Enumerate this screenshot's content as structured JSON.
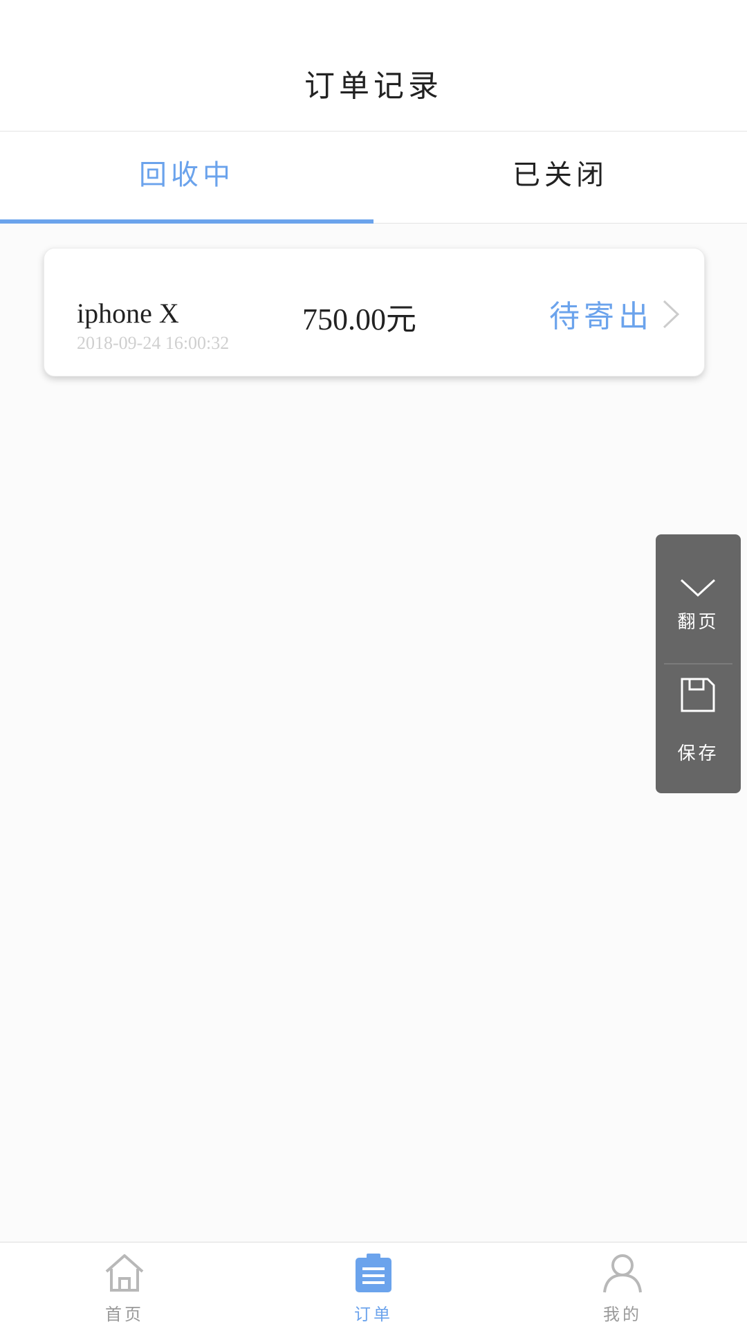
{
  "header": {
    "title": "订单记录"
  },
  "tabs": [
    {
      "label": "回收中",
      "active": true
    },
    {
      "label": "已关闭",
      "active": false
    }
  ],
  "orders": [
    {
      "name": "iphone X",
      "date": "2018-09-24 16:00:32",
      "price": "750.00元",
      "status": "待寄出"
    }
  ],
  "float_panel": {
    "page_label": "翻页",
    "save_label": "保存"
  },
  "bottom_nav": [
    {
      "label": "首页",
      "icon": "home-icon",
      "active": false
    },
    {
      "label": "订单",
      "icon": "clipboard-icon",
      "active": true
    },
    {
      "label": "我的",
      "icon": "user-icon",
      "active": false
    }
  ],
  "colors": {
    "accent": "#6ba3ec",
    "text": "#222222",
    "muted": "#cfcfcf",
    "nav_inactive": "#9a9a9a",
    "float_bg": "#666666"
  }
}
